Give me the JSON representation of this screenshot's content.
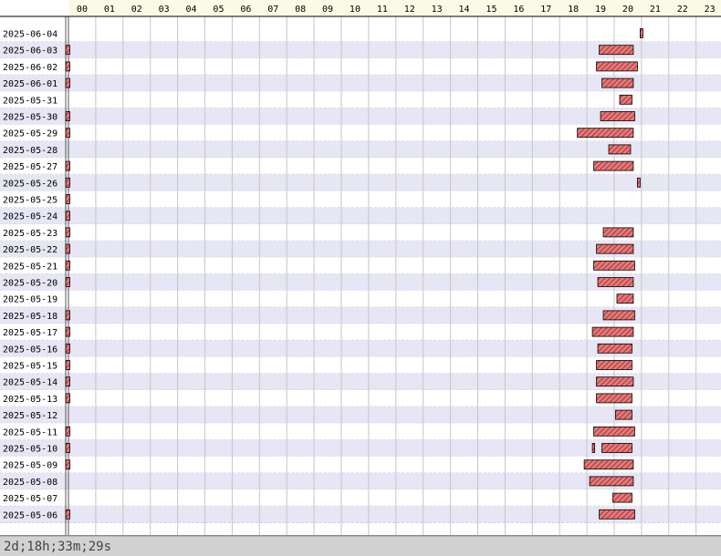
{
  "chart_data": {
    "type": "timeline",
    "x_ticks": [
      "00",
      "01",
      "02",
      "03",
      "04",
      "05",
      "06",
      "07",
      "08",
      "09",
      "10",
      "11",
      "12",
      "13",
      "14",
      "15",
      "16",
      "17",
      "18",
      "19",
      "20",
      "21",
      "22",
      "23"
    ],
    "xlim": [
      0,
      24
    ],
    "rows": [
      {
        "date": "2025-06-04",
        "bars": [
          [
            20.95,
            21.05
          ]
        ]
      },
      {
        "date": "2025-06-03",
        "bars": [
          [
            -0.1,
            0.05
          ],
          [
            19.45,
            20.7
          ]
        ]
      },
      {
        "date": "2025-06-02",
        "bars": [
          [
            -0.1,
            0.05
          ],
          [
            19.35,
            20.85
          ]
        ]
      },
      {
        "date": "2025-06-01",
        "bars": [
          [
            -0.1,
            0.05
          ],
          [
            19.55,
            20.7
          ]
        ]
      },
      {
        "date": "2025-05-31",
        "bars": [
          [
            20.2,
            20.65
          ]
        ]
      },
      {
        "date": "2025-05-30",
        "bars": [
          [
            -0.1,
            0.05
          ],
          [
            19.5,
            20.75
          ]
        ]
      },
      {
        "date": "2025-05-29",
        "bars": [
          [
            -0.1,
            0.05
          ],
          [
            18.65,
            20.7
          ]
        ]
      },
      {
        "date": "2025-05-28",
        "bars": [
          [
            19.8,
            20.6
          ]
        ]
      },
      {
        "date": "2025-05-27",
        "bars": [
          [
            -0.1,
            0.05
          ],
          [
            19.25,
            20.7
          ]
        ]
      },
      {
        "date": "2025-05-26",
        "bars": [
          [
            -0.1,
            0.05
          ],
          [
            20.85,
            20.95
          ]
        ]
      },
      {
        "date": "2025-05-25",
        "bars": [
          [
            -0.1,
            0.05
          ]
        ]
      },
      {
        "date": "2025-05-24",
        "bars": [
          [
            -0.1,
            0.05
          ]
        ]
      },
      {
        "date": "2025-05-23",
        "bars": [
          [
            -0.1,
            0.05
          ],
          [
            19.6,
            20.7
          ]
        ]
      },
      {
        "date": "2025-05-22",
        "bars": [
          [
            -0.1,
            0.05
          ],
          [
            19.35,
            20.7
          ]
        ]
      },
      {
        "date": "2025-05-21",
        "bars": [
          [
            -0.1,
            0.05
          ],
          [
            19.25,
            20.75
          ]
        ]
      },
      {
        "date": "2025-05-20",
        "bars": [
          [
            -0.1,
            0.05
          ],
          [
            19.4,
            20.7
          ]
        ]
      },
      {
        "date": "2025-05-19",
        "bars": [
          [
            20.1,
            20.7
          ]
        ]
      },
      {
        "date": "2025-05-18",
        "bars": [
          [
            -0.1,
            0.05
          ],
          [
            19.6,
            20.75
          ]
        ]
      },
      {
        "date": "2025-05-17",
        "bars": [
          [
            -0.1,
            0.05
          ],
          [
            19.2,
            20.7
          ]
        ]
      },
      {
        "date": "2025-05-16",
        "bars": [
          [
            -0.1,
            0.05
          ],
          [
            19.4,
            20.65
          ]
        ]
      },
      {
        "date": "2025-05-15",
        "bars": [
          [
            -0.1,
            0.05
          ],
          [
            19.35,
            20.65
          ]
        ]
      },
      {
        "date": "2025-05-14",
        "bars": [
          [
            -0.1,
            0.05
          ],
          [
            19.35,
            20.7
          ]
        ]
      },
      {
        "date": "2025-05-13",
        "bars": [
          [
            -0.1,
            0.05
          ],
          [
            19.35,
            20.65
          ]
        ]
      },
      {
        "date": "2025-05-12",
        "bars": [
          [
            20.05,
            20.65
          ]
        ]
      },
      {
        "date": "2025-05-11",
        "bars": [
          [
            -0.1,
            0.05
          ],
          [
            19.25,
            20.75
          ]
        ]
      },
      {
        "date": "2025-05-10",
        "bars": [
          [
            -0.1,
            0.05
          ],
          [
            19.2,
            19.27
          ],
          [
            19.55,
            20.65
          ]
        ]
      },
      {
        "date": "2025-05-09",
        "bars": [
          [
            -0.1,
            0.05
          ],
          [
            18.9,
            20.7
          ]
        ]
      },
      {
        "date": "2025-05-08",
        "bars": [
          [
            19.1,
            20.7
          ]
        ]
      },
      {
        "date": "2025-05-07",
        "bars": [
          [
            19.95,
            20.65
          ]
        ]
      },
      {
        "date": "2025-05-06",
        "bars": [
          [
            -0.1,
            0.05
          ],
          [
            19.45,
            20.75
          ]
        ]
      }
    ],
    "colors": {
      "bar_fill": "#e87878",
      "bar_stroke": "#000000",
      "hatch": "#8a2a2a",
      "row_alt": "#e6e6f4",
      "grid": "#c6c6c6",
      "header_bg": "#fbfae6"
    }
  },
  "footer": {
    "total": "2d;18h;33m;29s"
  }
}
